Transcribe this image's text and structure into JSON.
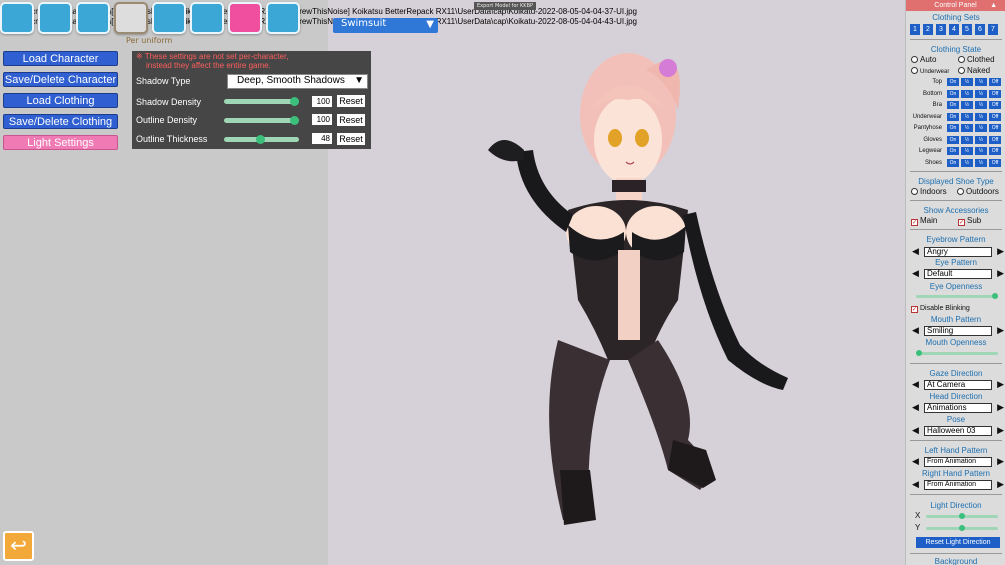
{
  "notifications": [
    "UI screenshot saved to C:\\[ScrewThisNoise] Koikatsu BetterRepack RX11\\1\\[ScrewThisNoise] Koikatsu BetterRepack RX11\\UserData\\cap\\Koikatu-2022-08-05-04-04-37-UI.jpg",
    "UI screenshot saved to C:\\[ScrewThisNoise] Koikatsu BetterRepack RX11\\1\\[ScrewThisNoise] Koikatsu BetterRepack RX11\\UserData\\cap\\Koikatu-2022-08-05-04-04-43-UI.jpg"
  ],
  "export_tag": "Export Model for KKBP",
  "toolbar": {
    "per_uniform": "Per uniform",
    "outfit": "Swimsuit"
  },
  "left_menu": {
    "load_character": "Load Character",
    "save_delete_character": "Save/Delete Character",
    "load_clothing": "Load Clothing",
    "save_delete_clothing": "Save/Delete Clothing",
    "light_settings": "Light Settings"
  },
  "settings": {
    "note_line1": "※ These settings are not set per-character,",
    "note_line2": "instead they affect the entire game.",
    "shadow_type_label": "Shadow Type",
    "shadow_type_value": "Deep, Smooth Shadows",
    "shadow_density_label": "Shadow Density",
    "shadow_density_value": "100",
    "outline_density_label": "Outline Density",
    "outline_density_value": "100",
    "outline_thickness_label": "Outline Thickness",
    "outline_thickness_value": "48",
    "reset_label": "Reset"
  },
  "panel": {
    "title": "Control Panel",
    "clothing_sets_head": "Clothing Sets",
    "sets": [
      "1",
      "2",
      "3",
      "4",
      "5",
      "6",
      "7"
    ],
    "clothing_state_head": "Clothing State",
    "auto": "Auto",
    "clothed": "Clothed",
    "underwear": "Underwear",
    "naked": "Naked",
    "state_rows": [
      "Top",
      "Bottom",
      "Bra",
      "Underwear",
      "Pantyhose",
      "Gloves",
      "Legwear",
      "Shoes"
    ],
    "state_opts": [
      "On",
      "½",
      "½",
      "Off"
    ],
    "shoe_head": "Displayed Shoe Type",
    "indoors": "Indoors",
    "outdoors": "Outdoors",
    "accessories_head": "Show Accessories",
    "main": "Main",
    "sub": "Sub",
    "eyebrow_head": "Eyebrow Pattern",
    "eyebrow_value": "Angry",
    "eye_head": "Eye Pattern",
    "eye_value": "Default",
    "eye_openness_head": "Eye Openness",
    "disable_blinking": "Disable Blinking",
    "mouth_head": "Mouth Pattern",
    "mouth_value": "Smiling",
    "mouth_openness_head": "Mouth Openness",
    "gaze_head": "Gaze Direction",
    "gaze_value": "At Camera",
    "head_dir_head": "Head Direction",
    "head_dir_value": "Animations",
    "pose_head": "Pose",
    "pose_value": "Halloween 03",
    "left_hand_head": "Left Hand Pattern",
    "left_hand_value": "From Animation",
    "right_hand_head": "Right Hand Pattern",
    "right_hand_value": "From Animation",
    "light_dir_head": "Light Direction",
    "x_label": "X",
    "y_label": "Y",
    "reset_light": "Reset Light Direction",
    "background_head": "Background"
  },
  "levels": {
    "shadow_density": 1.0,
    "outline_density": 1.0,
    "outline_thickness": 0.48,
    "eye_openness": 1.0,
    "mouth_openness": 0.0,
    "light_x": 0.5,
    "light_y": 0.5
  },
  "colors": {
    "accent_blue": "#1d5fc7",
    "slider_green": "#3bbf7b",
    "pink": "#f07ab4",
    "panel_title": "#e07070"
  }
}
